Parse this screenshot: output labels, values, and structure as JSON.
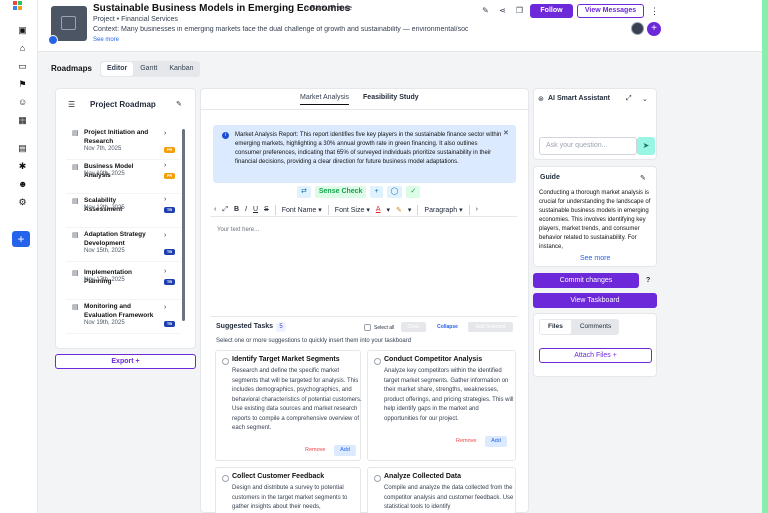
{
  "header": {
    "title": "Sustainable Business Models in Emerging Economies",
    "location": "Paris, France",
    "subtitle": "Project • Financial Services",
    "context": "Context: Many businesses in emerging markets face the dual challenge of growth and sustainability — environmental/social...",
    "see_more": "See more",
    "follow": "Follow",
    "view_messages": "View Messages"
  },
  "roadmaps": {
    "label": "Roadmaps",
    "tabs": [
      "Editor",
      "Gantt",
      "Kanban"
    ],
    "panel_title": "Project Roadmap",
    "items": [
      {
        "name": "Project Initiation and Research",
        "date": "Nov 7th, 2025",
        "tag": "PR",
        "tag_color": "#f59e0b"
      },
      {
        "name": "Business Model Analysis",
        "date": "Nov 10th, 2025",
        "tag": "PR",
        "tag_color": "#f59e0b"
      },
      {
        "name": "Scalability Assessment",
        "date": "Nov 12th, 2025",
        "tag": "TB",
        "tag_color": "#1e40af"
      },
      {
        "name": "Adaptation Strategy Development",
        "date": "Nov 15th, 2025",
        "tag": "TB",
        "tag_color": "#1e40af"
      },
      {
        "name": "Implementation Planning",
        "date": "Nov 17th, 2025",
        "tag": "TB",
        "tag_color": "#1e40af"
      },
      {
        "name": "Monitoring and Evaluation Framework",
        "date": "Nov 19th, 2025",
        "tag": "TB",
        "tag_color": "#1e40af"
      }
    ],
    "export": "Export +"
  },
  "editor": {
    "tabs": [
      "Market Analysis",
      "Feasibility Study"
    ],
    "report": "Market Analysis Report: This report identifies five key players in the sustainable finance sector within emerging markets, highlighting a 30% annual growth rate in green financing. It also outlines consumer preferences, indicating that 65% of surveyed individuals prioritize sustainability in their financial decisions, providing a clear direction for future business model adaptations.",
    "sense_check": "Sense Check",
    "toolbar": {
      "font_name": "Font Name",
      "font_size": "Font Size",
      "paragraph": "Paragraph"
    },
    "placeholder": "Your text here..."
  },
  "suggested": {
    "title": "Suggested Tasks",
    "count": "5",
    "desc": "Select one or more suggestions to quickly insert them into your taskboard",
    "select_all": "Select all",
    "clear": "Clear",
    "collapse": "Collapse",
    "add_selected": "Add Selected",
    "remove": "Remove",
    "add": "Add",
    "cards": [
      {
        "title": "Identify Target Market Segments",
        "desc": "Research and define the specific market segments that will be targeted for analysis. This includes demographics, psychographics, and behavioral characteristics of potential customers. Use existing data sources and market research reports to compile a comprehensive overview of each segment."
      },
      {
        "title": "Conduct Competitor Analysis",
        "desc": "Analyze key competitors within the identified target market segments. Gather information on their market share, strengths, weaknesses, product offerings, and pricing strategies. This will help identify gaps in the market and opportunities for our project."
      },
      {
        "title": "Collect Customer Feedback",
        "desc": "Design and distribute a survey to potential customers in the target market segments to gather insights about their needs,"
      },
      {
        "title": "Analyze Collected Data",
        "desc": "Compile and analyze the data collected from the competitor analysis and customer feedback. Use statistical tools to identify"
      }
    ]
  },
  "assistant": {
    "title": "AI Smart Assistant",
    "placeholder": "Ask your question...",
    "guide_title": "Guide",
    "guide_text": "Conducting a thorough market analysis is crucial for understanding the landscape of sustainable business models in emerging economies. This involves identifying key players, market trends, and consumer behavior related to sustainability. For instance,",
    "see_more": "See more",
    "commit": "Commit changes",
    "help": "?",
    "view_taskboard": "View Taskboard",
    "file_tabs": [
      "Files",
      "Comments"
    ],
    "attach": "Attach Files +"
  }
}
